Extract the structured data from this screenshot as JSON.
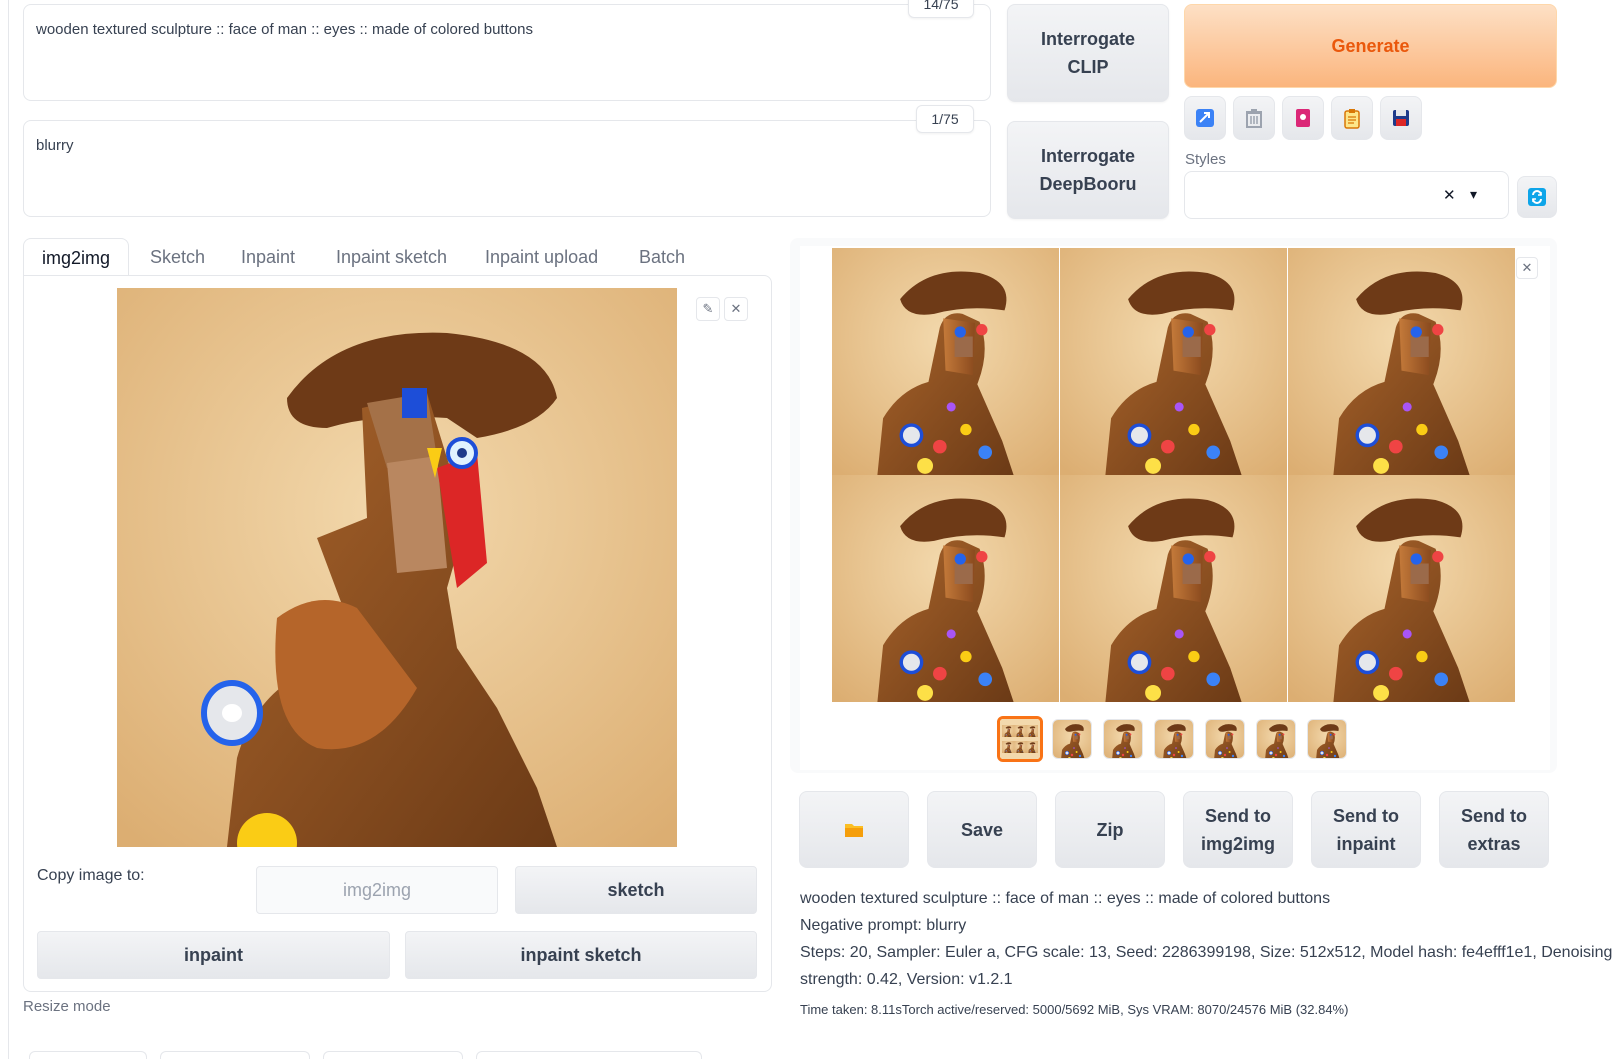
{
  "prompt": {
    "positive_text": "wooden textured  sculpture ::  face of man :: eyes :: made of colored buttons",
    "positive_token_count": "14/75",
    "negative_text": "blurry",
    "negative_token_count": "1/75"
  },
  "interrogate": {
    "clip_label_line1": "Interrogate",
    "clip_label_line2": "CLIP",
    "deepbooru_label_line1": "Interrogate",
    "deepbooru_label_line2": "DeepBooru"
  },
  "generate_label": "Generate",
  "tools": [
    {
      "icon": "arrow-check-icon",
      "color": "#3b82f6"
    },
    {
      "icon": "trash-icon",
      "color": "#9ca3af"
    },
    {
      "icon": "picture-icon",
      "color": "#db2777"
    },
    {
      "icon": "clipboard-icon",
      "color": "#d97706"
    },
    {
      "icon": "floppy-disk-icon",
      "color": "#1e3a8a"
    }
  ],
  "styles": {
    "label": "Styles",
    "clear_glyph": "✕",
    "dropdown_glyph": "▾"
  },
  "tabs": [
    {
      "label": "img2img",
      "active": true
    },
    {
      "label": "Sketch",
      "active": false
    },
    {
      "label": "Inpaint",
      "active": false
    },
    {
      "label": "Inpaint sketch",
      "active": false
    },
    {
      "label": "Inpaint upload",
      "active": false
    },
    {
      "label": "Batch",
      "active": false
    }
  ],
  "copy_image": {
    "label": "Copy image to:",
    "img2img": "img2img",
    "sketch": "sketch",
    "inpaint": "inpaint",
    "inpaint_sketch": "inpaint sketch"
  },
  "resize_mode_label": "Resize mode",
  "gallery": {
    "thumbnail_count": 7,
    "selected_index": 0
  },
  "actions": {
    "folder_icon": "folder-icon",
    "save": "Save",
    "zip": "Zip",
    "send_img2img_line1": "Send to",
    "send_img2img_line2": "img2img",
    "send_inpaint_line1": "Send to",
    "send_inpaint_line2": "inpaint",
    "send_extras_line1": "Send to",
    "send_extras_line2": "extras"
  },
  "info": {
    "prompt_line": "wooden textured sculpture :: face of man :: eyes :: made of colored buttons",
    "negative_line": "Negative prompt: blurry",
    "params_line1": "Steps: 20, Sampler: Euler a, CFG scale: 13, Seed: 2286399198, Size: 512x512, Model hash: fe4efff1e1, Denoising",
    "params_line2": "strength: 0.42, Version: v1.2.1",
    "time_line": "Time taken: 8.11sTorch active/reserved: 5000/5692 MiB, Sys VRAM: 8070/24576 MiB (32.84%)"
  },
  "colors": {
    "accent": "#f97316",
    "generate_text": "#ea580c",
    "border": "#e5e7eb"
  }
}
